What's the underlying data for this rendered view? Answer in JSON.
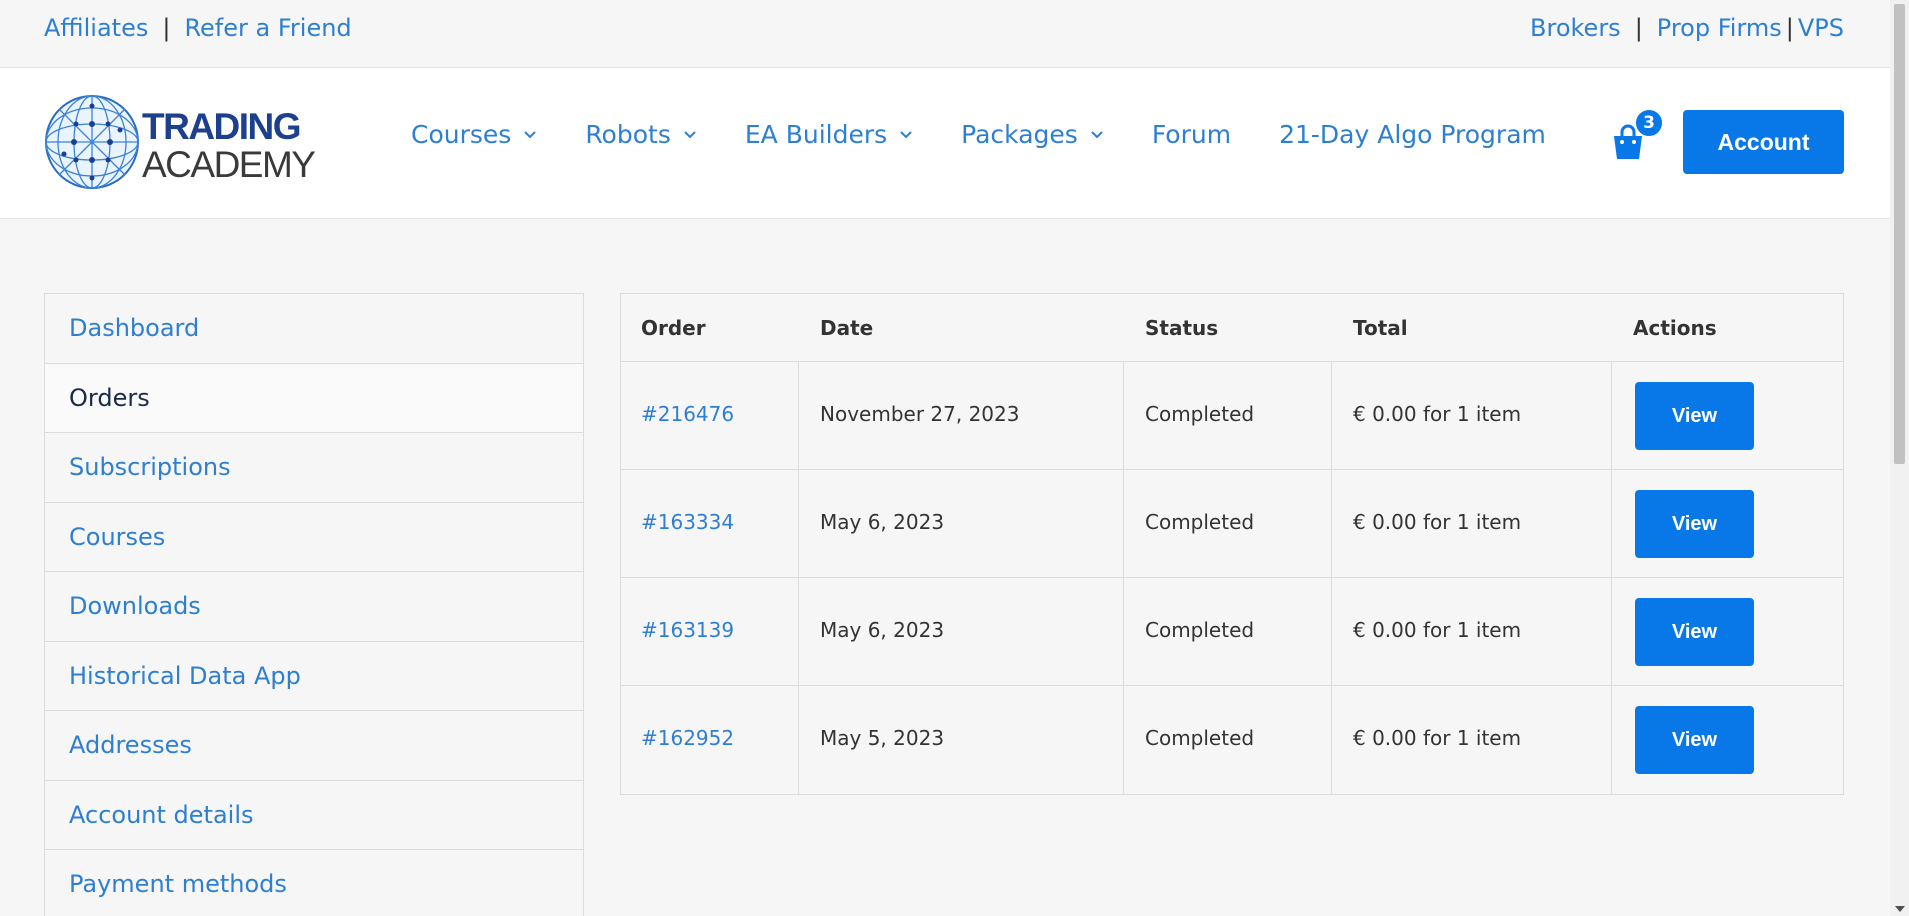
{
  "topbar": {
    "left_links": [
      "Affiliates",
      "Refer a Friend"
    ],
    "left_separator": "|",
    "right_links": [
      "Brokers",
      "Prop Firms",
      "VPS"
    ],
    "right_separator": "|"
  },
  "header": {
    "logo": {
      "line1": "TRADING",
      "line2": "ACADEMY"
    },
    "nav": [
      {
        "label": "Courses",
        "dropdown": true
      },
      {
        "label": "Robots",
        "dropdown": true
      },
      {
        "label": "EA Builders",
        "dropdown": true
      },
      {
        "label": "Packages",
        "dropdown": true
      },
      {
        "label": "Forum",
        "dropdown": false
      },
      {
        "label": "21-Day Algo Program",
        "dropdown": false
      }
    ],
    "cart_count": "3",
    "account_label": "Account"
  },
  "sidebar": {
    "items": [
      {
        "label": "Dashboard",
        "active": false
      },
      {
        "label": "Orders",
        "active": true
      },
      {
        "label": "Subscriptions",
        "active": false
      },
      {
        "label": "Courses",
        "active": false
      },
      {
        "label": "Downloads",
        "active": false
      },
      {
        "label": "Historical Data App",
        "active": false
      },
      {
        "label": "Addresses",
        "active": false
      },
      {
        "label": "Account details",
        "active": false
      },
      {
        "label": "Payment methods",
        "active": false
      }
    ]
  },
  "orders": {
    "columns": [
      "Order",
      "Date",
      "Status",
      "Total",
      "Actions"
    ],
    "rows": [
      {
        "order": "#216476",
        "date": "November 27, 2023",
        "status": "Completed",
        "total": "€ 0.00 for 1 item",
        "action": "View"
      },
      {
        "order": "#163334",
        "date": "May 6, 2023",
        "status": "Completed",
        "total": "€ 0.00 for 1 item",
        "action": "View"
      },
      {
        "order": "#163139",
        "date": "May 6, 2023",
        "status": "Completed",
        "total": "€ 0.00 for 1 item",
        "action": "View"
      },
      {
        "order": "#162952",
        "date": "May 5, 2023",
        "status": "Completed",
        "total": "€ 0.00 for 1 item",
        "action": "View"
      }
    ]
  },
  "colors": {
    "link": "#2e7fd1",
    "primary": "#0877e8",
    "background": "#f6f6f6"
  }
}
